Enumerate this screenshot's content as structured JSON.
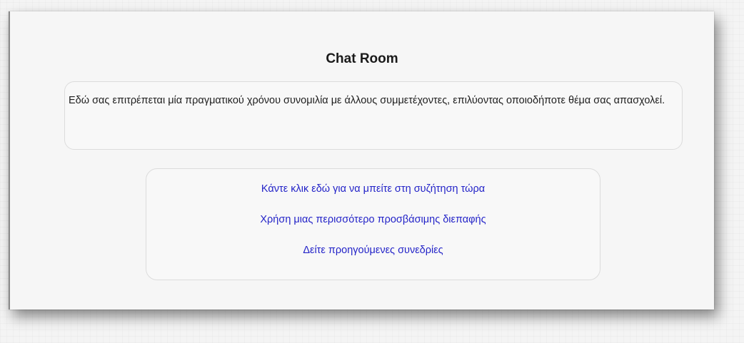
{
  "page": {
    "title": "Chat Room",
    "intro": "Εδώ σας επιτρέπεται μία πραγματικού χρόνου συνομιλία με άλλους συμμετέχοντες, επιλύοντας οποιοδήποτε θέμα σας απασχολεί."
  },
  "links": [
    {
      "label": "Κάντε κλικ εδώ για να μπείτε στη συζήτηση τώρα"
    },
    {
      "label": "Χρήση μιας περισσότερο προσβάσιμης διεπαφής"
    },
    {
      "label": "Δείτε προηγούμενες συνεδρίες"
    }
  ],
  "colors": {
    "link": "#2323c8",
    "text": "#1e1e1e",
    "panel": "#f6f6f6"
  }
}
